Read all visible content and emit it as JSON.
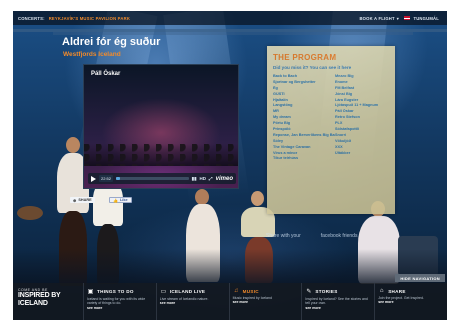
{
  "topbar": {
    "concerts_label": "CONCERTS:",
    "concerts_park": "REYKJAVÍK'S MUSIC PAVILION PARK",
    "book_label": "BOOK A FLIGHT",
    "language": "TUNGUMÁL"
  },
  "song": {
    "title": "Aldrei fór ég suður",
    "subtitle": "Westfjords Iceland"
  },
  "video": {
    "artist": "Páll Óskar",
    "time": "22:52",
    "progress_fraction": 0.05,
    "hd_label": "HD",
    "vimeo_label": "vimeo"
  },
  "program": {
    "title": "THE PROGRAM",
    "tagline": "Did you miss it? You can see it here",
    "songs": [
      "Back to Bach",
      "Mezzo Big",
      "Sjortnar og Bergshetter",
      "Enome",
      "Ég",
      "FM Belfast",
      "GÚSTI",
      "Jónsi Big",
      "Hjaltalín",
      "Lára Eugster",
      "Langstöng",
      "Ljótaspuð 11 + Magnum",
      "MR",
      "Páll Óskar",
      "My dream",
      "Retro Stefson",
      "Pörtu Big",
      "PLX",
      "Prinspóló",
      "Sólstafapottli",
      "Reponse, Jan Berverlikens Big Band",
      "Snorri",
      "Sóley",
      "Vökuljóð",
      "The Vintage Caravan",
      "XXX",
      "Virus a minor",
      "Ùltákber",
      "Tíkur teirhúss",
      ""
    ]
  },
  "social": {
    "share_label": "SHARE",
    "like_label": "Like"
  },
  "stage_text": {
    "left": "Share with your",
    "right": "facebook friends"
  },
  "hide_nav_label": "HIDE NAVIGATION",
  "bottom": {
    "brand_top": "COME AND BE",
    "brand_main": "INSPIRED BY ICELAND",
    "items": [
      {
        "label": "THINGS TO DO",
        "desc": "Iceland is waiting for you with its wide variety of things to do.",
        "more": "see more",
        "icon": "camera-icon"
      },
      {
        "label": "ICELAND LIVE",
        "desc": "Live stream of Icelandic nature.",
        "more": "see more",
        "icon": "tv-icon"
      },
      {
        "label": "MUSIC",
        "desc": "Music inspired by Iceland",
        "more": "see more",
        "icon": "music-icon"
      },
      {
        "label": "STORIES",
        "desc": "Inspired by Iceland? See the stories and tell your own.",
        "more": "see more",
        "icon": "pencil-icon"
      },
      {
        "label": "SHARE",
        "desc": "Join the project. Get Inspired.",
        "more": "see more",
        "icon": "house-icon"
      }
    ]
  }
}
